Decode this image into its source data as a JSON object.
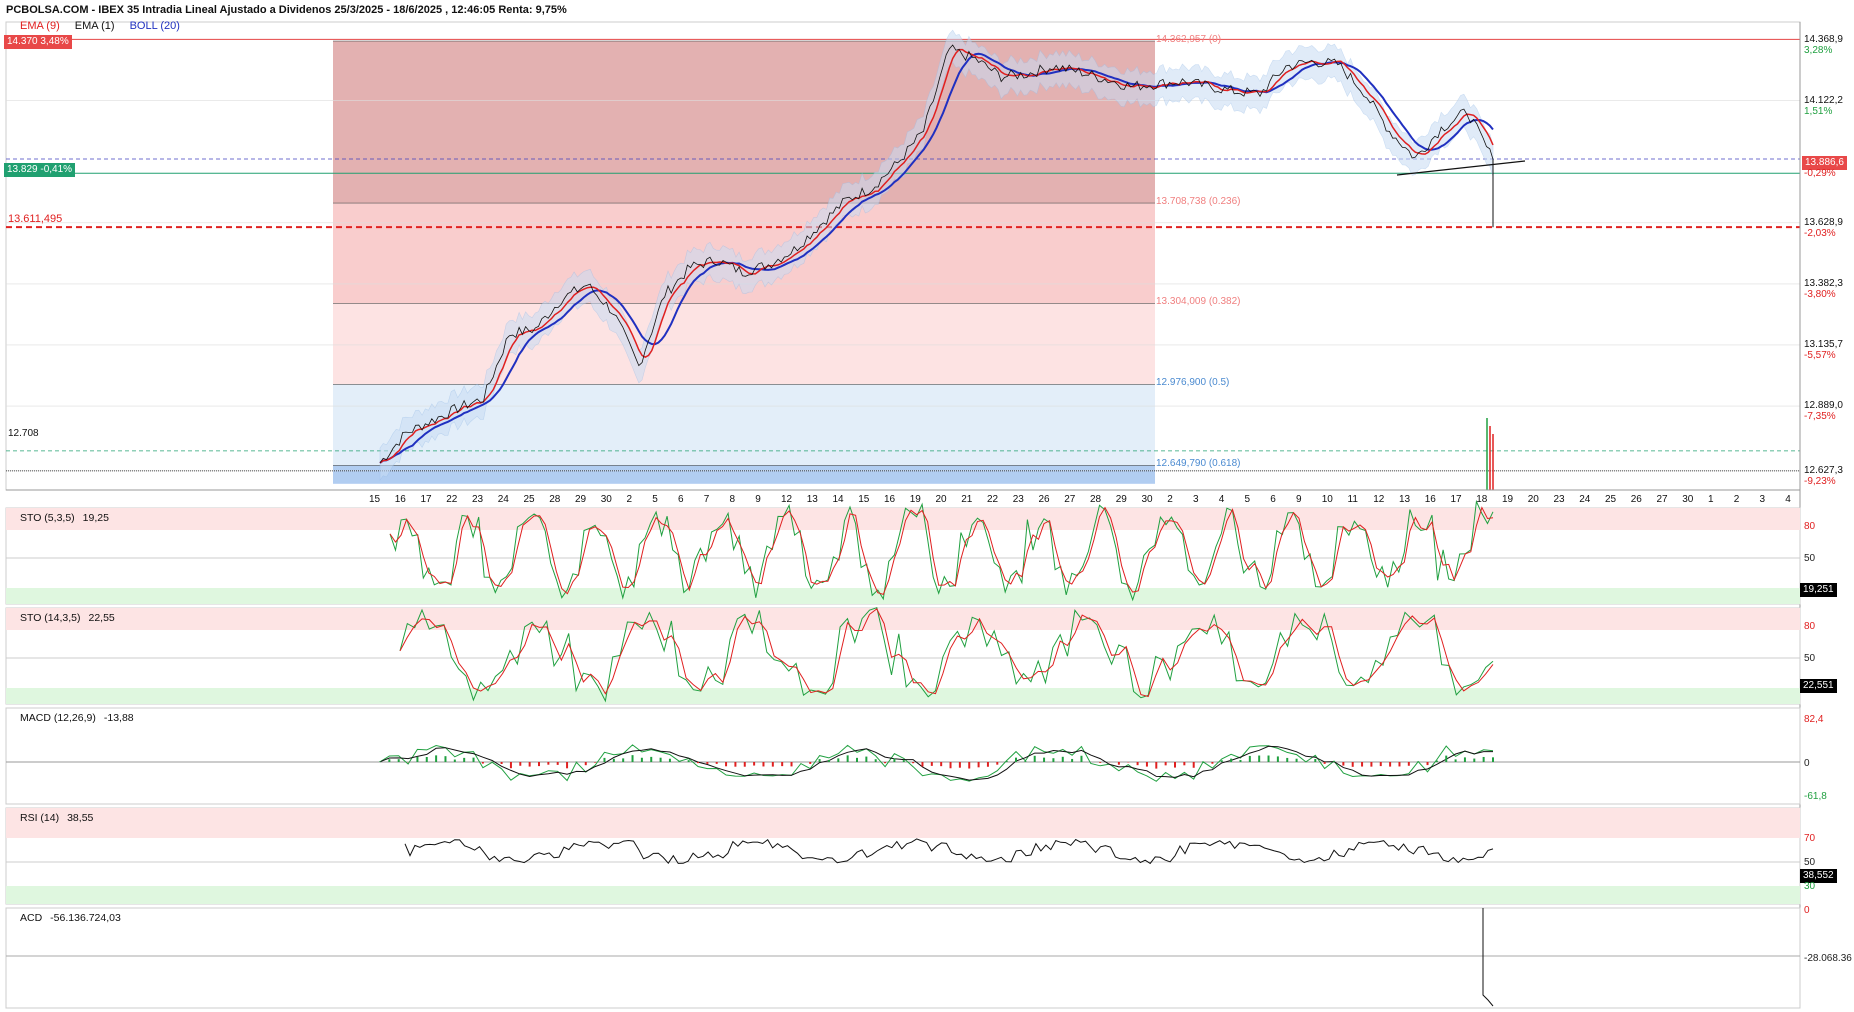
{
  "header": {
    "title": "PCBOLSA.COM - IBEX 35 Intradia Lineal Ajustado a Dividenos 25/3/2025 - 18/6/2025 , 12:46:05 Renta: 9,75%",
    "legend": [
      {
        "label": "EMA (9)",
        "color": "#e02020"
      },
      {
        "label": "EMA (1)",
        "color": "#111111"
      },
      {
        "label": "BOLL (20)",
        "color": "#2030c0"
      }
    ]
  },
  "badges": {
    "high": "14.370  3,48%",
    "current": "13.829  -0,41%",
    "support_label": "13.611,495",
    "low_label": "12.708",
    "last_price_axis": "13.886,6",
    "last_price_pct": "-0,29%"
  },
  "fib_levels": [
    {
      "label": "14.362,957 (0)",
      "value": 14362.957,
      "color": "#f08080"
    },
    {
      "label": "13.708,738 (0.236)",
      "value": 13708.738,
      "color": "#f08080"
    },
    {
      "label": "13.304,009 (0.382)",
      "value": 13304.009,
      "color": "#f08080"
    },
    {
      "label": "12.976,900 (0.5)",
      "value": 12976.9,
      "color": "#4a8ad0"
    },
    {
      "label": "12.649,790 (0.618)",
      "value": 12649.79,
      "color": "#4a8ad0"
    }
  ],
  "price_axis": [
    {
      "value": "14.368,9",
      "pct": "3,28%",
      "pct_color": "#20a040"
    },
    {
      "value": "14.122,2",
      "pct": "1,51%",
      "pct_color": "#20a040"
    },
    {
      "value": "13.628,9",
      "pct": "-2,03%",
      "pct_color": "#e02020"
    },
    {
      "value": "13.382,3",
      "pct": "-3,80%",
      "pct_color": "#e02020"
    },
    {
      "value": "13.135,7",
      "pct": "-5,57%",
      "pct_color": "#e02020"
    },
    {
      "value": "12.889,0",
      "pct": "-7,35%",
      "pct_color": "#e02020"
    },
    {
      "value": "12.627,3",
      "pct": "-9,23%",
      "pct_color": "#e02020"
    }
  ],
  "date_axis": [
    "15",
    "16",
    "17",
    "22",
    "23",
    "24",
    "25",
    "28",
    "29",
    "30",
    "2",
    "5",
    "6",
    "7",
    "8",
    "9",
    "12",
    "13",
    "14",
    "15",
    "16",
    "19",
    "20",
    "21",
    "22",
    "23",
    "26",
    "27",
    "28",
    "29",
    "30",
    "2",
    "3",
    "4",
    "5",
    "6",
    "9",
    "10",
    "11",
    "12",
    "13",
    "16",
    "17",
    "18",
    "19",
    "20",
    "23",
    "24",
    "25",
    "26",
    "27",
    "30",
    "1",
    "2",
    "3",
    "4"
  ],
  "panes": {
    "sto1": {
      "title": "STO (5,3,5)",
      "value": "19,25",
      "box": "19,251",
      "levels": [
        "80",
        "50"
      ]
    },
    "sto2": {
      "title": "STO (14,3,5)",
      "value": "22,55",
      "box": "22,551",
      "levels": [
        "80",
        "50"
      ]
    },
    "macd": {
      "title": "MACD (12,26,9)",
      "value": "-13,88",
      "levels": [
        "82,4",
        "0",
        "-61,8"
      ]
    },
    "rsi": {
      "title": "RSI (14)",
      "value": "38,55",
      "box": "38,552",
      "levels": [
        "70",
        "50",
        "30"
      ]
    },
    "acd": {
      "title": "ACD",
      "value": "-56.136.724,03",
      "levels": [
        "0",
        "-28.068.36"
      ]
    }
  },
  "colors": {
    "up": "#20a040",
    "down": "#e02020",
    "ema9": "#e02020",
    "boll": "#2030c0",
    "band": "#c8dcf4"
  },
  "chart_data": {
    "type": "line",
    "title": "PCBOLSA.COM - IBEX 35 Intradia Lineal Ajustado a Dividenos 25/3/2025 - 18/6/2025",
    "ylim": [
      12550,
      14440
    ],
    "x": [
      "15",
      "16",
      "17",
      "22",
      "23",
      "24",
      "25",
      "28",
      "29",
      "30",
      "2",
      "5",
      "6",
      "7",
      "8",
      "9",
      "12",
      "13",
      "14",
      "15",
      "16",
      "19",
      "20",
      "21",
      "22",
      "23",
      "26",
      "27",
      "28",
      "29",
      "30",
      "2",
      "3",
      "4",
      "5",
      "6",
      "9",
      "10",
      "11",
      "12",
      "13",
      "16",
      "17",
      "18"
    ],
    "series": [
      {
        "name": "EMA (1)",
        "values": [
          12660,
          12780,
          12830,
          12880,
          12920,
          13180,
          13200,
          13320,
          13380,
          13270,
          13050,
          13340,
          13450,
          13480,
          13430,
          13460,
          13520,
          13620,
          13720,
          13770,
          13870,
          14000,
          14330,
          14290,
          14220,
          14230,
          14260,
          14240,
          14210,
          14180,
          14190,
          14200,
          14180,
          14160,
          14150,
          14260,
          14280,
          14270,
          14160,
          14000,
          13890,
          14010,
          14080,
          13885
        ]
      }
    ]
  }
}
